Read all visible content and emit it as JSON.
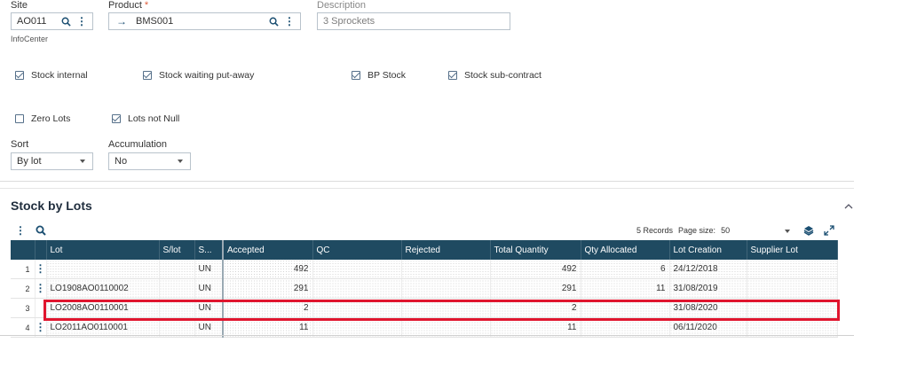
{
  "site": {
    "label": "Site",
    "value": "AO011",
    "sub": "InfoCenter"
  },
  "product": {
    "label": "Product",
    "required_mark": "*",
    "value": "BMS001"
  },
  "description": {
    "label": "Description",
    "value": "3 Sprockets"
  },
  "checkboxes": [
    {
      "label": "Stock internal",
      "checked": true
    },
    {
      "label": "Stock waiting put-away",
      "checked": true
    },
    {
      "label": "BP Stock",
      "checked": true
    },
    {
      "label": "Stock sub-contract",
      "checked": true
    },
    {
      "label": "Zero Lots",
      "checked": false
    },
    {
      "label": "Lots not Null",
      "checked": true
    }
  ],
  "sort": {
    "label": "Sort",
    "value": "By lot"
  },
  "accumulation": {
    "label": "Accumulation",
    "value": "No"
  },
  "section": {
    "title": "Stock by Lots",
    "records": "5 Records",
    "page_size_label": "Page size:",
    "page_size": "50"
  },
  "table": {
    "columns": [
      "Lot",
      "S/lot",
      "S...",
      "Accepted",
      "QC",
      "Rejected",
      "Total Quantity",
      "Qty Allocated",
      "Lot Creation",
      "Supplier Lot"
    ],
    "rows": [
      {
        "n": "1",
        "lot": "",
        "slot": "",
        "s": "UN",
        "accepted": "492",
        "qc": "",
        "rejected": "",
        "total": "492",
        "allocated": "6",
        "creation": "24/12/2018",
        "supplier": ""
      },
      {
        "n": "2",
        "lot": "LO1908AO0110002",
        "slot": "",
        "s": "UN",
        "accepted": "291",
        "qc": "",
        "rejected": "",
        "total": "291",
        "allocated": "11",
        "creation": "31/08/2019",
        "supplier": ""
      },
      {
        "n": "3",
        "lot": "LO2008AO0110001",
        "slot": "",
        "s": "UN",
        "accepted": "2",
        "qc": "",
        "rejected": "",
        "total": "2",
        "allocated": "",
        "creation": "31/08/2020",
        "supplier": ""
      },
      {
        "n": "4",
        "lot": "LO2011AO0110001",
        "slot": "",
        "s": "UN",
        "accepted": "11",
        "qc": "",
        "rejected": "",
        "total": "11",
        "allocated": "",
        "creation": "06/11/2020",
        "supplier": ""
      }
    ]
  },
  "colors": {
    "header_bg": "#1f4a61",
    "accent": "#1b4f72",
    "highlight": "#e0152e"
  }
}
